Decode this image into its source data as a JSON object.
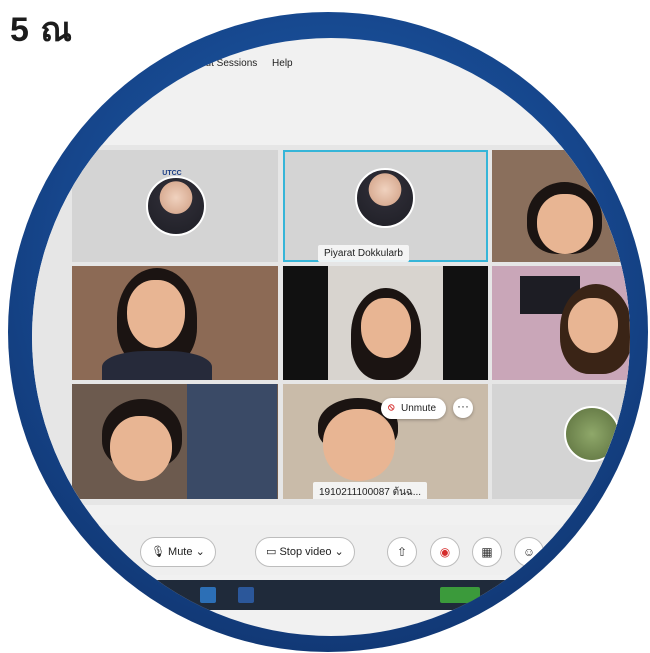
{
  "heading": "5 ณ",
  "menu": {
    "items": [
      "out Sessions",
      "Help"
    ]
  },
  "participants": {
    "selected_name": "Piyarat Dokkularb",
    "tile_logo_text": "UTCC",
    "unmuted_tile_label": "1910211100087 ต้นฉ...",
    "unmute_label": "Unmute",
    "more_glyph": "···"
  },
  "controls": {
    "mute_label": "Mute",
    "stop_video_label": "Stop video"
  },
  "colors": {
    "ring_outer": "#0c2a5e",
    "ring_mid": "#1f63b3",
    "selected_outline": "#36b5d8",
    "mic_off": "#d63030"
  }
}
